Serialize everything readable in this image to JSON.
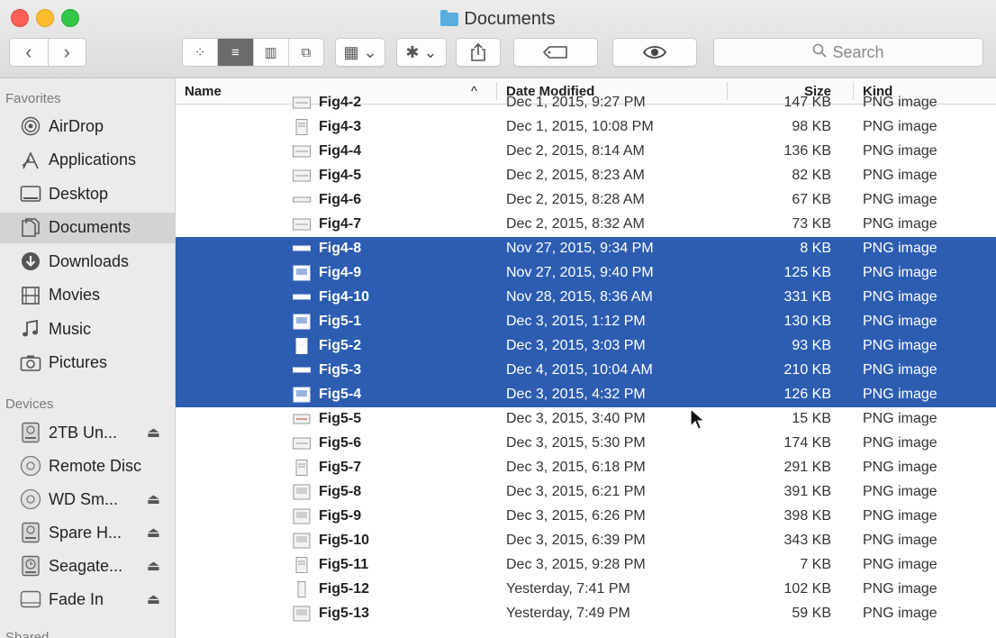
{
  "window": {
    "title": "Documents"
  },
  "toolbar": {
    "back_label": "‹",
    "forward_label": "›",
    "view_icons": [
      "⁘",
      "≡",
      "▥",
      "⧉"
    ],
    "arrange_label": "▦ ⌄",
    "action_label": "✱ ⌄",
    "search_placeholder": "Search"
  },
  "sidebar": {
    "favorites_label": "Favorites",
    "favorites": [
      {
        "label": "AirDrop",
        "icon": "airdrop-icon"
      },
      {
        "label": "Applications",
        "icon": "applications-icon"
      },
      {
        "label": "Desktop",
        "icon": "desktop-icon"
      },
      {
        "label": "Documents",
        "icon": "documents-icon",
        "selected": true
      },
      {
        "label": "Downloads",
        "icon": "downloads-icon"
      },
      {
        "label": "Movies",
        "icon": "movies-icon"
      },
      {
        "label": "Music",
        "icon": "music-icon"
      },
      {
        "label": "Pictures",
        "icon": "pictures-icon"
      }
    ],
    "devices_label": "Devices",
    "devices": [
      {
        "label": "2TB Un...",
        "icon": "drive-icon",
        "eject": "⏏"
      },
      {
        "label": "Remote Disc",
        "icon": "disc-icon",
        "eject": ""
      },
      {
        "label": "WD Sm...",
        "icon": "disc-icon",
        "eject": "⏏"
      },
      {
        "label": "Spare H...",
        "icon": "drive-icon",
        "eject": "⏏"
      },
      {
        "label": "Seagate...",
        "icon": "timemachine-icon",
        "eject": "⏏"
      },
      {
        "label": "Fade In",
        "icon": "volume-icon",
        "eject": "⏏"
      }
    ],
    "shared_label": "Shared"
  },
  "columns": {
    "name": "Name",
    "sort_arrow": "^",
    "date": "Date Modified",
    "size": "Size",
    "kind": "Kind"
  },
  "files": [
    {
      "name": "Fig4-2",
      "date": "Dec 1, 2015, 9:27 PM",
      "size": "147 KB",
      "kind": "PNG image",
      "selected": false
    },
    {
      "name": "Fig4-3",
      "date": "Dec 1, 2015, 10:08 PM",
      "size": "98 KB",
      "kind": "PNG image",
      "selected": false
    },
    {
      "name": "Fig4-4",
      "date": "Dec 2, 2015, 8:14 AM",
      "size": "136 KB",
      "kind": "PNG image",
      "selected": false
    },
    {
      "name": "Fig4-5",
      "date": "Dec 2, 2015, 8:23 AM",
      "size": "82 KB",
      "kind": "PNG image",
      "selected": false
    },
    {
      "name": "Fig4-6",
      "date": "Dec 2, 2015, 8:28 AM",
      "size": "67 KB",
      "kind": "PNG image",
      "selected": false
    },
    {
      "name": "Fig4-7",
      "date": "Dec 2, 2015, 8:32 AM",
      "size": "73 KB",
      "kind": "PNG image",
      "selected": false
    },
    {
      "name": "Fig4-8",
      "date": "Nov 27, 2015, 9:34 PM",
      "size": "8 KB",
      "kind": "PNG image",
      "selected": true
    },
    {
      "name": "Fig4-9",
      "date": "Nov 27, 2015, 9:40 PM",
      "size": "125 KB",
      "kind": "PNG image",
      "selected": true
    },
    {
      "name": "Fig4-10",
      "date": "Nov 28, 2015, 8:36 AM",
      "size": "331 KB",
      "kind": "PNG image",
      "selected": true
    },
    {
      "name": "Fig5-1",
      "date": "Dec 3, 2015, 1:12 PM",
      "size": "130 KB",
      "kind": "PNG image",
      "selected": true
    },
    {
      "name": "Fig5-2",
      "date": "Dec 3, 2015, 3:03 PM",
      "size": "93 KB",
      "kind": "PNG image",
      "selected": true
    },
    {
      "name": "Fig5-3",
      "date": "Dec 4, 2015, 10:04 AM",
      "size": "210 KB",
      "kind": "PNG image",
      "selected": true
    },
    {
      "name": "Fig5-4",
      "date": "Dec 3, 2015, 4:32 PM",
      "size": "126 KB",
      "kind": "PNG image",
      "selected": true
    },
    {
      "name": "Fig5-5",
      "date": "Dec 3, 2015, 3:40 PM",
      "size": "15 KB",
      "kind": "PNG image",
      "selected": false
    },
    {
      "name": "Fig5-6",
      "date": "Dec 3, 2015, 5:30 PM",
      "size": "174 KB",
      "kind": "PNG image",
      "selected": false
    },
    {
      "name": "Fig5-7",
      "date": "Dec 3, 2015, 6:18 PM",
      "size": "291 KB",
      "kind": "PNG image",
      "selected": false
    },
    {
      "name": "Fig5-8",
      "date": "Dec 3, 2015, 6:21 PM",
      "size": "391 KB",
      "kind": "PNG image",
      "selected": false
    },
    {
      "name": "Fig5-9",
      "date": "Dec 3, 2015, 6:26 PM",
      "size": "398 KB",
      "kind": "PNG image",
      "selected": false
    },
    {
      "name": "Fig5-10",
      "date": "Dec 3, 2015, 6:39 PM",
      "size": "343 KB",
      "kind": "PNG image",
      "selected": false
    },
    {
      "name": "Fig5-11",
      "date": "Dec 3, 2015, 9:28 PM",
      "size": "7 KB",
      "kind": "PNG image",
      "selected": false
    },
    {
      "name": "Fig5-12",
      "date": "Yesterday, 7:41 PM",
      "size": "102 KB",
      "kind": "PNG image",
      "selected": false
    },
    {
      "name": "Fig5-13",
      "date": "Yesterday, 7:49 PM",
      "size": "59 KB",
      "kind": "PNG image",
      "selected": false
    }
  ],
  "colors": {
    "selection": "#2d5db1",
    "sidebar_bg": "#ebebeb"
  }
}
